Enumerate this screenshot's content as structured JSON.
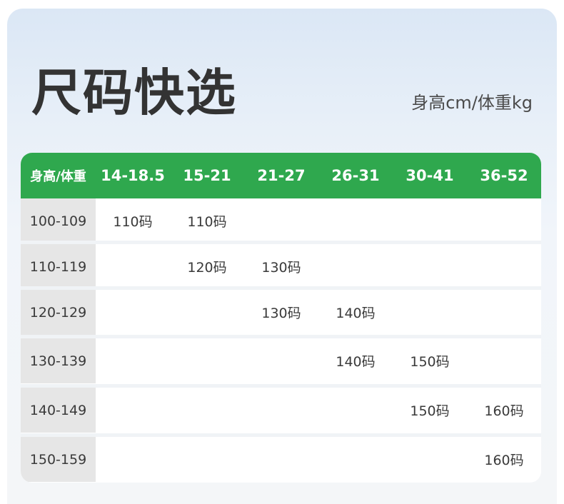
{
  "header": {
    "title": "尺码快选",
    "subtitle": "身高cm/体重kg"
  },
  "table": {
    "corner_label": "身高/体重",
    "columns": [
      "14-18.5",
      "15-21",
      "21-27",
      "26-31",
      "30-41",
      "36-52"
    ],
    "rows": [
      {
        "label": "100-109",
        "cells": [
          "110码",
          "110码",
          "",
          "",
          "",
          ""
        ]
      },
      {
        "label": "110-119",
        "cells": [
          "",
          "120码",
          "130码",
          "",
          "",
          ""
        ]
      },
      {
        "label": "120-129",
        "cells": [
          "",
          "",
          "130码",
          "140码",
          "",
          ""
        ]
      },
      {
        "label": "130-139",
        "cells": [
          "",
          "",
          "",
          "140码",
          "150码",
          ""
        ]
      },
      {
        "label": "140-149",
        "cells": [
          "",
          "",
          "",
          "",
          "150码",
          "160码"
        ]
      },
      {
        "label": "150-159",
        "cells": [
          "",
          "",
          "",
          "",
          "",
          "160码"
        ]
      }
    ]
  },
  "colors": {
    "header_green": "#2fa84e",
    "row_label_gray": "#e6e6e6",
    "text_dark": "#333333"
  }
}
